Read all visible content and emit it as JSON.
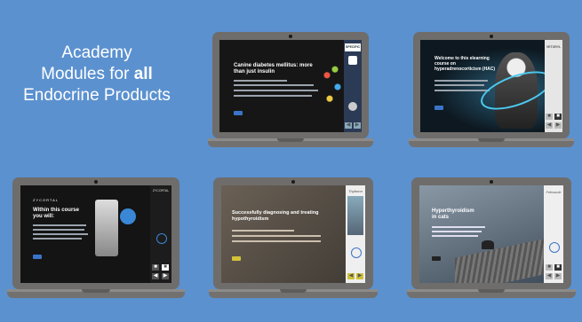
{
  "heading": {
    "line1": "Academy",
    "line2a": "Modules for ",
    "line2b": "all",
    "line3": "Endocrine Products"
  },
  "modules": [
    {
      "headline": "Canine diabetes mellitus: more than just insulin",
      "brand": "SPECIFIC"
    },
    {
      "headline": "Welcome to this elearning course on hyperadrenocorticism (HAC)",
      "brand": "VETORYL"
    },
    {
      "headline": "Within this course you will:",
      "brand": "ZYCORTAL"
    },
    {
      "headline": "Successfully diagnosing and treating hypothyroidism",
      "brand": "Thyforon"
    },
    {
      "headline": "Hyperthyroidism in cats",
      "brand": "Felimazole"
    }
  ],
  "colors": {
    "background": "#5b91cf",
    "laptop": "#6e6d6b",
    "accent": "#3a74c8"
  }
}
